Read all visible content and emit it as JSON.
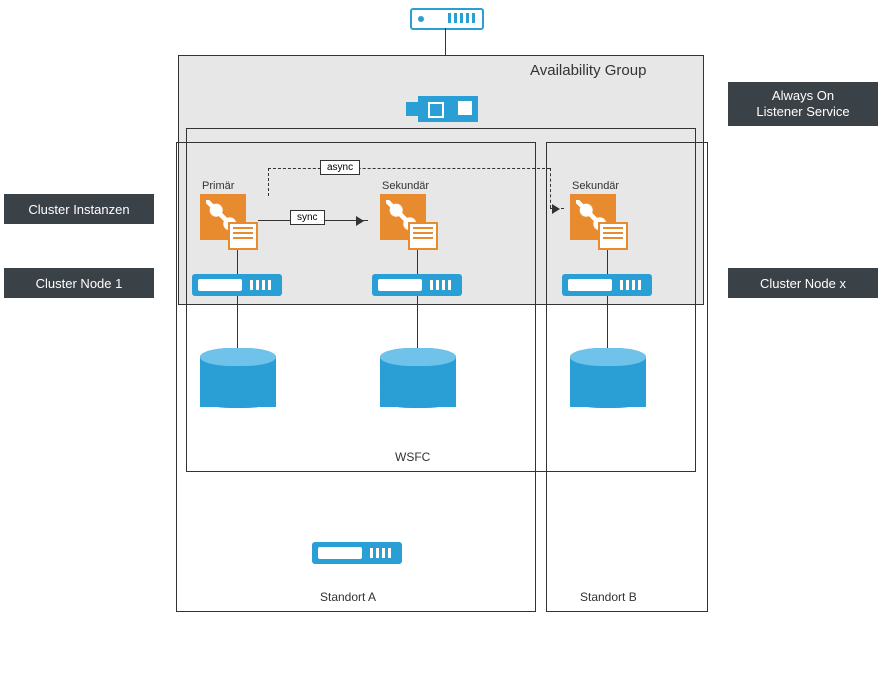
{
  "labels": {
    "cluster_instanzen": "Cluster Instanzen",
    "cluster_node_1": "Cluster Node 1",
    "cluster_node_x": "Cluster Node x",
    "always_on": "Always On\nListener Service",
    "availability_group": "Availability Group",
    "wsfc": "WSFC",
    "standort_a": "Standort A",
    "standort_b": "Standort B",
    "primar": "Primär",
    "sekundar1": "Sekundär",
    "sekundar2": "Sekundär",
    "sync": "sync",
    "async": "async"
  },
  "colors": {
    "blue": "#2a9fd6",
    "orange": "#e88b2e",
    "dark": "#3a4147",
    "grey": "#e7e7e7"
  }
}
